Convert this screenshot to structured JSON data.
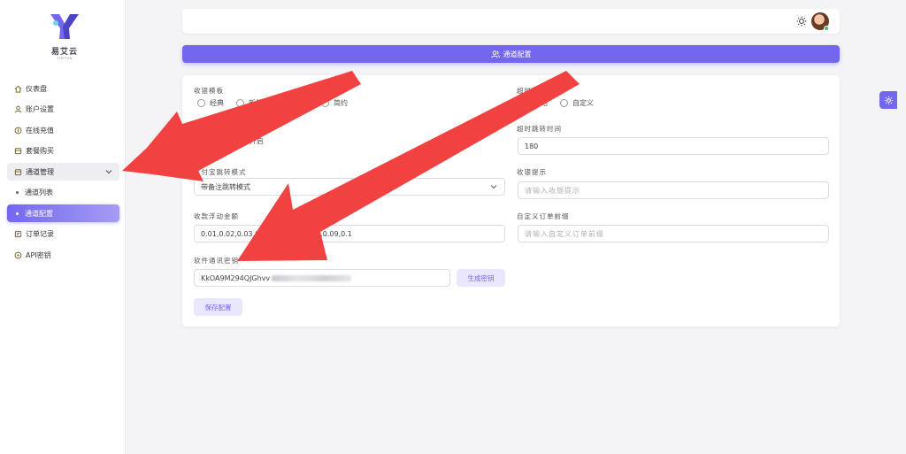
{
  "brand": {
    "name": "易艾云",
    "sub": "YIAIYUN",
    "color": "#7367f0"
  },
  "sidebar": {
    "items": [
      {
        "label": "仪表盘",
        "icon": "home-icon"
      },
      {
        "label": "账户设置",
        "icon": "user-icon"
      },
      {
        "label": "在线充值",
        "icon": "coin-icon"
      },
      {
        "label": "套餐购买",
        "icon": "package-icon"
      },
      {
        "label": "通道管理",
        "icon": "channel-icon",
        "expanded": true
      },
      {
        "label": "通道列表",
        "sub": true
      },
      {
        "label": "通道配置",
        "sub": true,
        "active": true
      },
      {
        "label": "订单记录",
        "icon": "order-icon"
      },
      {
        "label": "API密钥",
        "icon": "key-icon"
      }
    ]
  },
  "header": {
    "theme_icon": "sun-icon",
    "avatar": "avatar"
  },
  "banner": {
    "title": "通道配置",
    "icon": "users-icon"
  },
  "form": {
    "cashier_template": {
      "label": "收银模板",
      "options": [
        "经典",
        "新版",
        "",
        "简约"
      ],
      "selected": 2
    },
    "toggle": {
      "option": "开启"
    },
    "timeout_mode": {
      "label": "超时跳转方式",
      "options": [
        "本站",
        "自定义"
      ],
      "selected": 0
    },
    "timeout_time": {
      "label": "超时跳转时间",
      "value": "180"
    },
    "alipay_mode": {
      "label": "支付宝跳转模式",
      "value": "带备注跳转模式"
    },
    "cashier_tip": {
      "label": "收银提示",
      "placeholder": "请输入收银提示"
    },
    "amount_float": {
      "label": "收款浮动金额",
      "value_start": "0.01,0.02,0.03,0",
      "value_end": "3,0.09,0.1"
    },
    "custom_prefix": {
      "label": "自定义订单前缀",
      "placeholder": "请输入自定义订单前缀"
    },
    "soft_key": {
      "label": "软件通讯密钥",
      "value": "KkOA9M294QJGhvv"
    },
    "gen_key_label": "生成密钥",
    "save_label": "保存配置"
  },
  "annotation_color": "#f24141"
}
